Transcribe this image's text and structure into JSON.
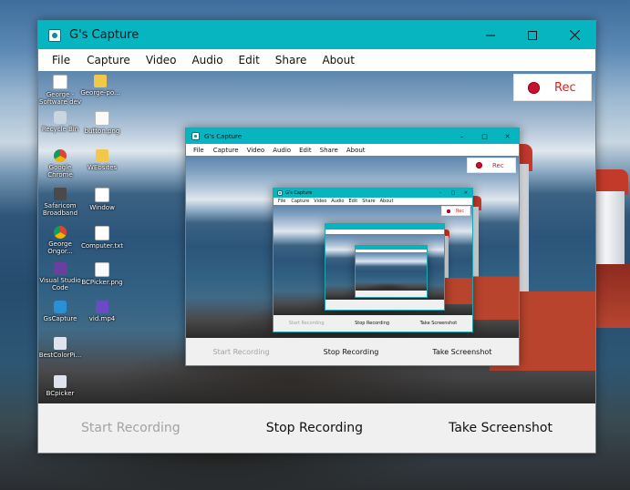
{
  "app": {
    "title": "G's Capture",
    "menu": [
      "File",
      "Capture",
      "Video",
      "Audio",
      "Edit",
      "Share",
      "About"
    ],
    "rec_label": "Rec",
    "buttons": {
      "start": "Start Recording",
      "stop": "Stop Recording",
      "screenshot": "Take Screenshot"
    }
  },
  "desktop_icons": [
    {
      "label": "George - Software dev",
      "icon": "doc-icon"
    },
    {
      "label": "George-po...",
      "icon": "folder-icon"
    },
    {
      "label": "Recycle Bin",
      "icon": "recycle-bin-icon"
    },
    {
      "label": "button.png",
      "icon": "image-file-icon"
    },
    {
      "label": "Google Chrome",
      "icon": "chrome-icon"
    },
    {
      "label": "WEbsites",
      "icon": "folder-icon"
    },
    {
      "label": "Safaricom Broadband",
      "icon": "modem-icon"
    },
    {
      "label": "Window",
      "icon": "doc-icon"
    },
    {
      "label": "George Ongor...",
      "icon": "chrome-icon"
    },
    {
      "label": "Computer.txt",
      "icon": "text-file-icon"
    },
    {
      "label": "Visual Studio Code",
      "icon": "vs-code-icon"
    },
    {
      "label": "BCPicker.png",
      "icon": "image-file-icon"
    },
    {
      "label": "GsCapture",
      "icon": "capture-app-icon"
    },
    {
      "label": "vid.mp4",
      "icon": "video-file-icon"
    },
    {
      "label": "BestColorPi...",
      "icon": "color-picker-icon"
    },
    {
      "label": "BCpicker",
      "icon": "color-picker-icon"
    }
  ],
  "colors": {
    "titlebar": "#06b5c0",
    "rec_dot": "#c8102e",
    "rec_text": "#e02020",
    "disabled_text": "#a3a3a3"
  }
}
